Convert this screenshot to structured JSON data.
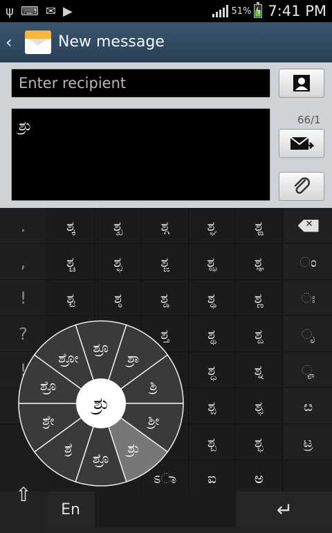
{
  "status_bar": {
    "battery_pct": "51%",
    "time": "7:41 PM",
    "battery_level": 0.51
  },
  "action_bar": {
    "title": "New message"
  },
  "compose": {
    "recipient_placeholder": "Enter recipient",
    "message_text": "ಶ್ರು",
    "counter": "66/1"
  },
  "keyboard": {
    "punctuation": [
      ".",
      ",",
      "!",
      "?",
      "!"
    ],
    "grid_rows": [
      [
        "ಶ್ಕ",
        "ಶ್ಖ",
        "ಶ್ಗ",
        "ಶ್ಘ",
        "ಶ್ಙ"
      ],
      [
        "ಶ್ಚ",
        "ಶ್ಛ",
        "ಶ್ಜ",
        "ಶ್ಝ",
        "ಶ್ಞ"
      ],
      [
        "ಶ್ಟ",
        "ಶ್ಠ",
        "ಶ್ಡ",
        "ಶ್ಢ",
        "ಶ್ಣ"
      ],
      [
        "",
        "",
        "ಶ್ತ",
        "ಶ್ಥ",
        "ಶ್ದ"
      ],
      [
        "",
        "",
        "",
        "ಶ್ಧ",
        "ಶ್ನ"
      ],
      [
        "",
        "",
        "",
        "ಶ್ಪ",
        "ಶ್ಫ"
      ],
      [
        "",
        "",
        "",
        "ಶ್ಬ",
        "ಶ್ಭ"
      ],
      [
        "",
        "",
        "ಽಾ",
        "ಐ",
        "ಅ"
      ]
    ],
    "right_keys": [
      "backspace",
      "ಂo",
      "ಃ",
      "ೃ",
      "ೄ",
      "ೞ",
      "ಟ್ರ"
    ],
    "right_labels": [
      "",
      "ಂ",
      "ಃ",
      "ೃ",
      "ೄ",
      "ೞ",
      "ಟ್ರ"
    ],
    "lang_label": "En",
    "enter_label": "↵",
    "shift_label": "⇧"
  },
  "radial_menu": {
    "center": "ಶ್ರು",
    "items": [
      "ಶ್ರೂ",
      "ಶ್ರಾ",
      "ಶ್ರಿ",
      "ಶ್ರೀ",
      "ಶ್ರು",
      "ಶ್ರೊ",
      "ಶ್ರೆ",
      "ಶ್ರೇ",
      "ಶ್ರೊ",
      "ಶ್ರೋ"
    ]
  }
}
